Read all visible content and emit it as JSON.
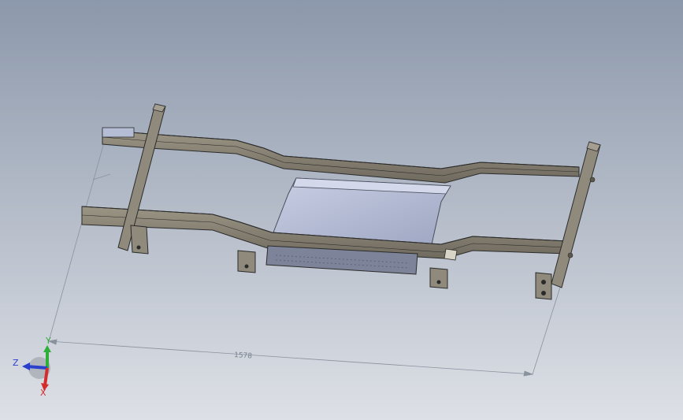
{
  "viewport": {
    "background_top": "#8c98ab",
    "background_bottom": "#dde0e6",
    "model_color": "#8a8476",
    "model_edge_color": "#2b2b2b",
    "panel_color": "#b8c0d8",
    "dimension_color": "#8a929e"
  },
  "dimension": {
    "value": "1578"
  },
  "triad": {
    "x_label": "X",
    "y_label": "Y",
    "z_label": "Z",
    "x_color": "#d42b2b",
    "y_color": "#2fae3a",
    "z_color": "#2b3fcf"
  }
}
